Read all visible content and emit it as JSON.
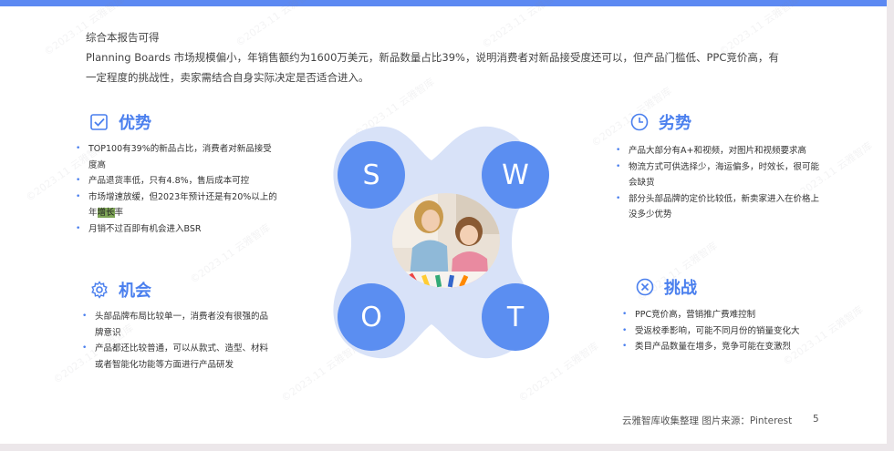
{
  "intro": {
    "heading": "综合本报告可得",
    "line1": "Planning Boards 市场规模偏小，年销售额约为1600万美元，新品数量占比39%，说明消费者对新品接受度还可以，但产品门槛低、PPC竞价高，有",
    "line2": "一定程度的挑战性，卖家需结合自身实际决定是否适合进入。"
  },
  "strengths": {
    "title": "优势",
    "icon": "checkbox-icon",
    "items": [
      "TOP100有39%的新品占比，消费者对新品接受",
      "度高",
      "产品退货率低，只有4.8%，售后成本可控",
      "市场增速放缓，但2023年预计还是有20%以上的",
      "年",
      "增长",
      "率",
      "月销不过百即有机会进入BSR"
    ]
  },
  "weaknesses": {
    "title": "劣势",
    "icon": "clock-icon",
    "items": [
      "产品大部分有A+和视频，对图片和视频要求高",
      "物流方式可供选择少，海运偏多，时效长，很可能",
      "会缺货",
      "部分头部品牌的定价比较低，新卖家进入在价格上",
      "没多少优势"
    ]
  },
  "opportunities": {
    "title": "机会",
    "icon": "gear-icon",
    "items": [
      "头部品牌布局比较单一，消费者没有很强的品",
      "牌意识",
      "产品都还比较普通，可以从款式、造型、材料",
      "或者智能化功能等方面进行产品研发"
    ]
  },
  "threats": {
    "title": "挑战",
    "icon": "x-circle-icon",
    "items": [
      "PPC竞价高，营销推广费难控制",
      "受返校季影响，可能不同月份的销量变化大",
      "类目产品数量在增多，竞争可能在变激烈"
    ]
  },
  "swot": {
    "s": "S",
    "w": "W",
    "o": "O",
    "t": "T"
  },
  "footer": {
    "source": "云雅智库收集整理   图片来源：Pinterest",
    "page": "5"
  },
  "watermark": "©2023.11 云雅智库",
  "colors": {
    "accent": "#4a7fee",
    "circle": "#5b8ef1",
    "blob": "#d8e2f8",
    "topbar": "#5c89f2"
  }
}
